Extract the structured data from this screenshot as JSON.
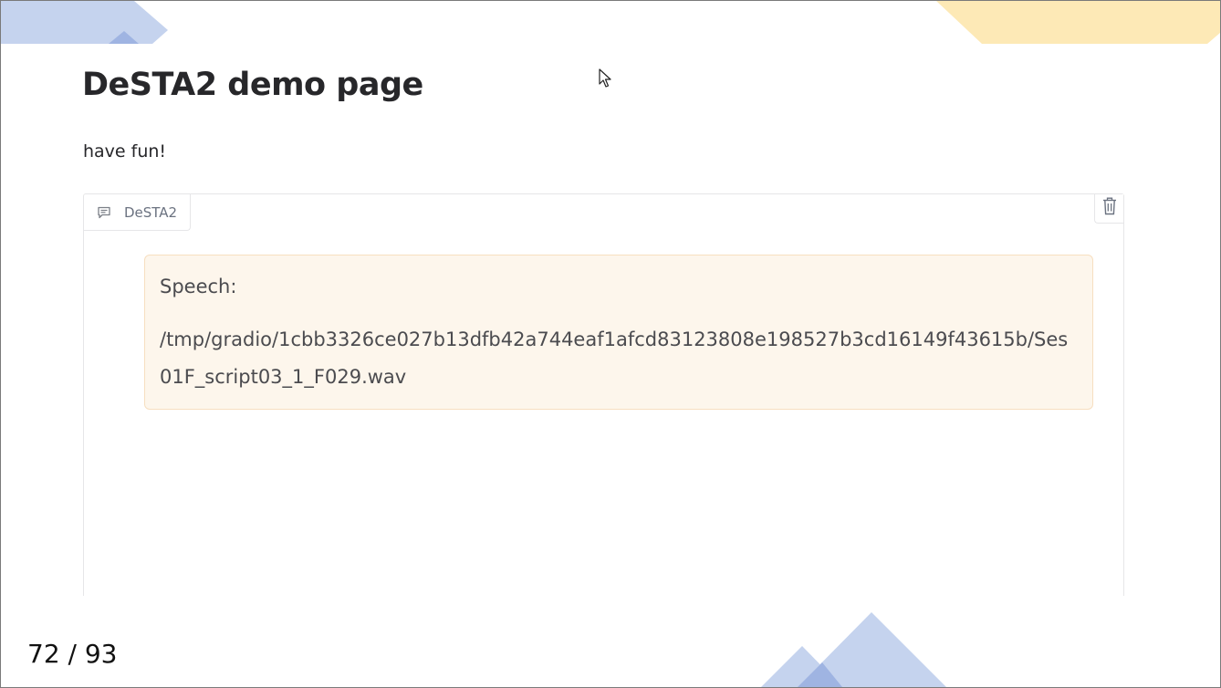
{
  "page": {
    "title": "DeSTA2 demo page",
    "subtitle": "have fun!"
  },
  "chatbot": {
    "label": "DeSTA2",
    "label_icon": "chat-icon",
    "clear_icon": "trash-icon",
    "messages": [
      {
        "heading": "Speech:",
        "path": "/tmp/gradio/1cbb3326ce027b13dfb42a744eaf1afcd83123808e198527b3cd16149f43615b/Ses01F_script03_1_F029.wav"
      }
    ]
  },
  "slide": {
    "page_number": "72 / 93"
  },
  "colors": {
    "deco_blue": "#c5d3ee",
    "deco_blue_dark": "#9fb4e2",
    "deco_yellow": "#fde9b6",
    "message_bg": "#fdf6ec",
    "message_border": "#f7dfc0"
  }
}
